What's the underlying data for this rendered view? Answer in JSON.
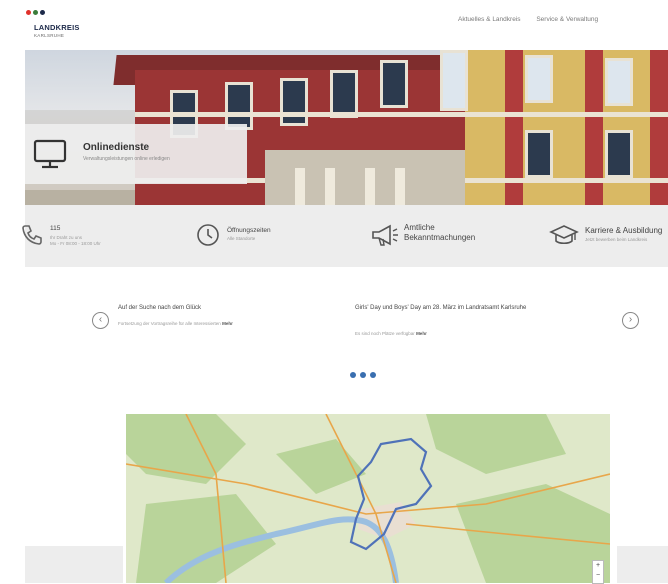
{
  "header": {
    "logo": {
      "title": "LANDKREIS",
      "subtitle": "KARLSRUHE",
      "dot_colors": [
        "#e0312b",
        "#3a7d3a",
        "#1d2a4a"
      ]
    },
    "nav": [
      "Aktuelles & Landkreis",
      "Service & Verwaltung"
    ]
  },
  "hero": {
    "card_title": "Onlinedienste",
    "card_subtitle": "Verwaltungsleistungen online erledigen"
  },
  "quick_links": [
    {
      "icon": "phone-icon",
      "title": "115",
      "sub1": "Ihr Draht zu uns",
      "sub2": "Mo - Fr 08:00 - 18:00 Uhr"
    },
    {
      "icon": "clock-icon",
      "title": "Öffnungszeiten",
      "sub1": "Alle Standorte"
    },
    {
      "icon": "megaphone-icon",
      "title": "Amtliche",
      "title2": "Bekanntmachungen"
    },
    {
      "icon": "graduation-cap-icon",
      "title": "Karriere & Ausbildung",
      "sub1": "Jetzt bewerben beim Landkreis"
    }
  ],
  "news": {
    "items": [
      {
        "title": "Auf der Suche nach dem Glück",
        "summary": "Fortsetzung der Vortragsreihe für alle Interessierten",
        "more": "Mehr"
      },
      {
        "title": "Girls' Day und Boys' Day am 28. März im Landratsamt Karlsruhe",
        "summary": "Es sind noch Plätze verfügbar",
        "more": "Mehr"
      }
    ],
    "prev_label": "‹",
    "next_label": "›",
    "pages": 3
  },
  "map": {
    "zoom_in": "+",
    "zoom_out": "−",
    "colors": {
      "land": "#dfe8c9",
      "forest": "#b9d49a",
      "water": "#9bbfe0",
      "road": "#e8a64a",
      "boundary": "#4f72b8",
      "town": "#e9dfd2"
    }
  },
  "colors": {
    "accent": "#3a6fb0",
    "bar": "#ededed"
  }
}
